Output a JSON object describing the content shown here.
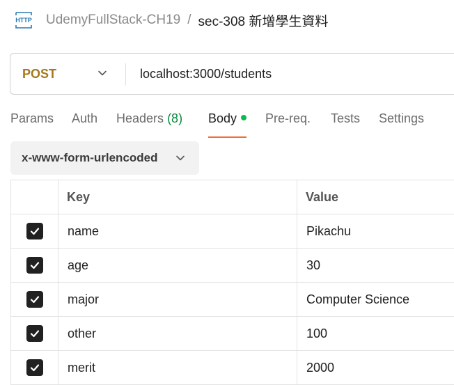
{
  "breadcrumb": {
    "icon": "http-icon",
    "collection": "UdemyFullStack-CH19",
    "separator": "/",
    "request_name": "sec-308 新增學生資料"
  },
  "request": {
    "method": "POST",
    "url": "localhost:3000/students"
  },
  "tabs": [
    {
      "label": "Params"
    },
    {
      "label": "Auth"
    },
    {
      "label": "Headers",
      "count": "(8)"
    },
    {
      "label": "Body",
      "active": true
    },
    {
      "label": "Pre-req."
    },
    {
      "label": "Tests"
    },
    {
      "label": "Settings"
    }
  ],
  "body_type": {
    "selected": "x-www-form-urlencoded"
  },
  "table": {
    "headers": {
      "key": "Key",
      "value": "Value"
    },
    "rows": [
      {
        "key": "name",
        "value": "Pikachu",
        "checked": true
      },
      {
        "key": "age",
        "value": "30",
        "checked": true
      },
      {
        "key": "major",
        "value": "Computer Science",
        "checked": true
      },
      {
        "key": "other",
        "value": "100",
        "checked": true
      },
      {
        "key": "merit",
        "value": "2000",
        "checked": true
      }
    ]
  },
  "colors": {
    "method": "#a5781b",
    "active_tab_underline": "#f26b3a",
    "body_dot": "#0cbb52",
    "header_count": "#0a8a3e"
  }
}
